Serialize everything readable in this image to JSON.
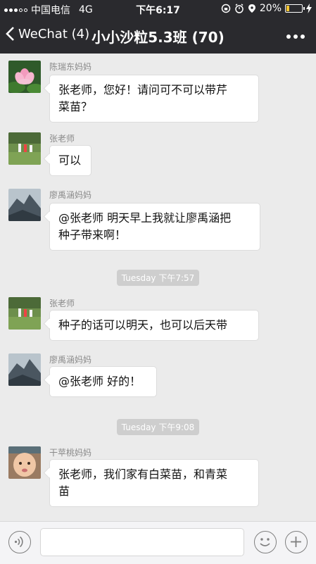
{
  "status_bar": {
    "carrier": "中国电信",
    "network": "4G",
    "time": "下午6:17",
    "battery_percent": "20%",
    "battery_level": 0.2,
    "battery_color": "#f6c431"
  },
  "nav": {
    "back_label": "WeChat (4)",
    "title": "小小沙粒5.3班 (70)",
    "more_icon": "more-dots-icon"
  },
  "messages": [
    {
      "sender": "陈瑞东妈妈",
      "avatar": "lotus-flower-avatar",
      "lines": [
        "张老师，您好！请问可不可以带芹",
        "菜苗？"
      ]
    },
    {
      "sender": "张老师",
      "avatar": "playground-avatar",
      "lines": [
        "可以"
      ]
    },
    {
      "sender": "廖禹涵妈妈",
      "avatar": "mountain-avatar",
      "lines": [
        "@张老师 明天早上我就让廖禹涵把",
        "种子带来啊！"
      ]
    },
    {
      "timestamp": "Tuesday 下午7:57"
    },
    {
      "sender": "张老师",
      "avatar": "playground-avatar",
      "lines": [
        "种子的话可以明天，也可以后天带"
      ]
    },
    {
      "sender": "廖禹涵妈妈",
      "avatar": "mountain-avatar",
      "lines": [
        "@张老师 好的！"
      ]
    },
    {
      "timestamp": "Tuesday 下午9:08"
    },
    {
      "sender": "干苹桃妈妈",
      "avatar": "baby-avatar",
      "lines": [
        "张老师，我们家有白菜苗，和青菜",
        "苗"
      ]
    }
  ],
  "input_bar": {
    "voice_icon": "voice-icon",
    "emoji_icon": "emoji-icon",
    "plus_icon": "plus-icon",
    "text_value": ""
  }
}
